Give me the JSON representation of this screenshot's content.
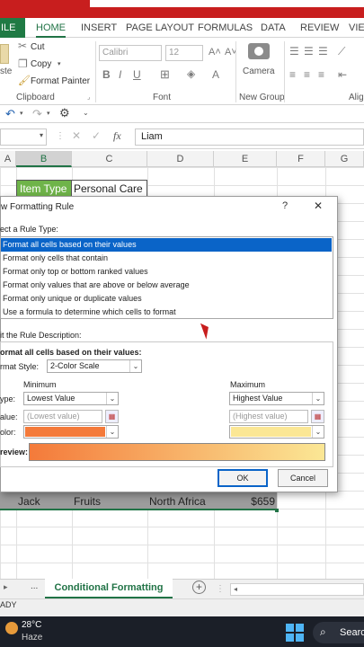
{
  "ribbon": {
    "file_tab": "ILE",
    "tabs": [
      "HOME",
      "INSERT",
      "PAGE LAYOUT",
      "FORMULAS",
      "DATA",
      "REVIEW",
      "VIEW"
    ],
    "clipboard": {
      "paste": "ste",
      "cut": "Cut",
      "copy": "Copy",
      "format_painter": "Format Painter",
      "label": "Clipboard"
    },
    "font": {
      "name": "Calibri",
      "size": "12",
      "label": "Font"
    },
    "camera": {
      "label": "Camera",
      "group_label": "New Group"
    },
    "align_label": "Alig"
  },
  "formula_bar": {
    "name_box": "",
    "fx": "fx",
    "value": "Liam"
  },
  "grid": {
    "columns": [
      "A",
      "B",
      "C",
      "D",
      "E",
      "F",
      "G"
    ],
    "row_top": [
      "Item Type",
      "Personal Care"
    ],
    "row_bottom": [
      "Jack",
      "Fruits",
      "North Africa",
      "$659"
    ]
  },
  "dialog": {
    "title": "w Formatting Rule",
    "help": "?",
    "close": "✕",
    "select_rule_label": "ect a Rule Type:",
    "rules": [
      "Format all cells based on their values",
      "Format only cells that contain",
      "Format only top or bottom ranked values",
      "Format only values that are above or below average",
      "Format only unique or duplicate values",
      "Use a formula to determine which cells to format"
    ],
    "edit_label": "it the Rule Description:",
    "heading": "ormat all cells based on their values:",
    "format_style_label": "rmat Style:",
    "format_style": "2-Color Scale",
    "minimum": "Minimum",
    "maximum": "Maximum",
    "type_label": "ype:",
    "value_label": "alue:",
    "color_label": "olor:",
    "min_type": "Lowest Value",
    "max_type": "Highest Value",
    "min_value_placeholder": "(Lowest value)",
    "max_value_placeholder": "(Highest value)",
    "min_color": "#f47a3a",
    "max_color": "#fbe795",
    "preview_label": "review:",
    "ok": "OK",
    "cancel": "Cancel"
  },
  "sheet": {
    "tab": "Conditional Formatting",
    "nav_dots": "...",
    "add": "+"
  },
  "status": {
    "ready": "ADY"
  },
  "taskbar": {
    "temp": "28°C",
    "weather": "Haze",
    "search": "Searc"
  },
  "colors": {
    "excel_green": "#217346",
    "selection_blue": "#0a64c8",
    "title_red": "#c81e1e"
  }
}
